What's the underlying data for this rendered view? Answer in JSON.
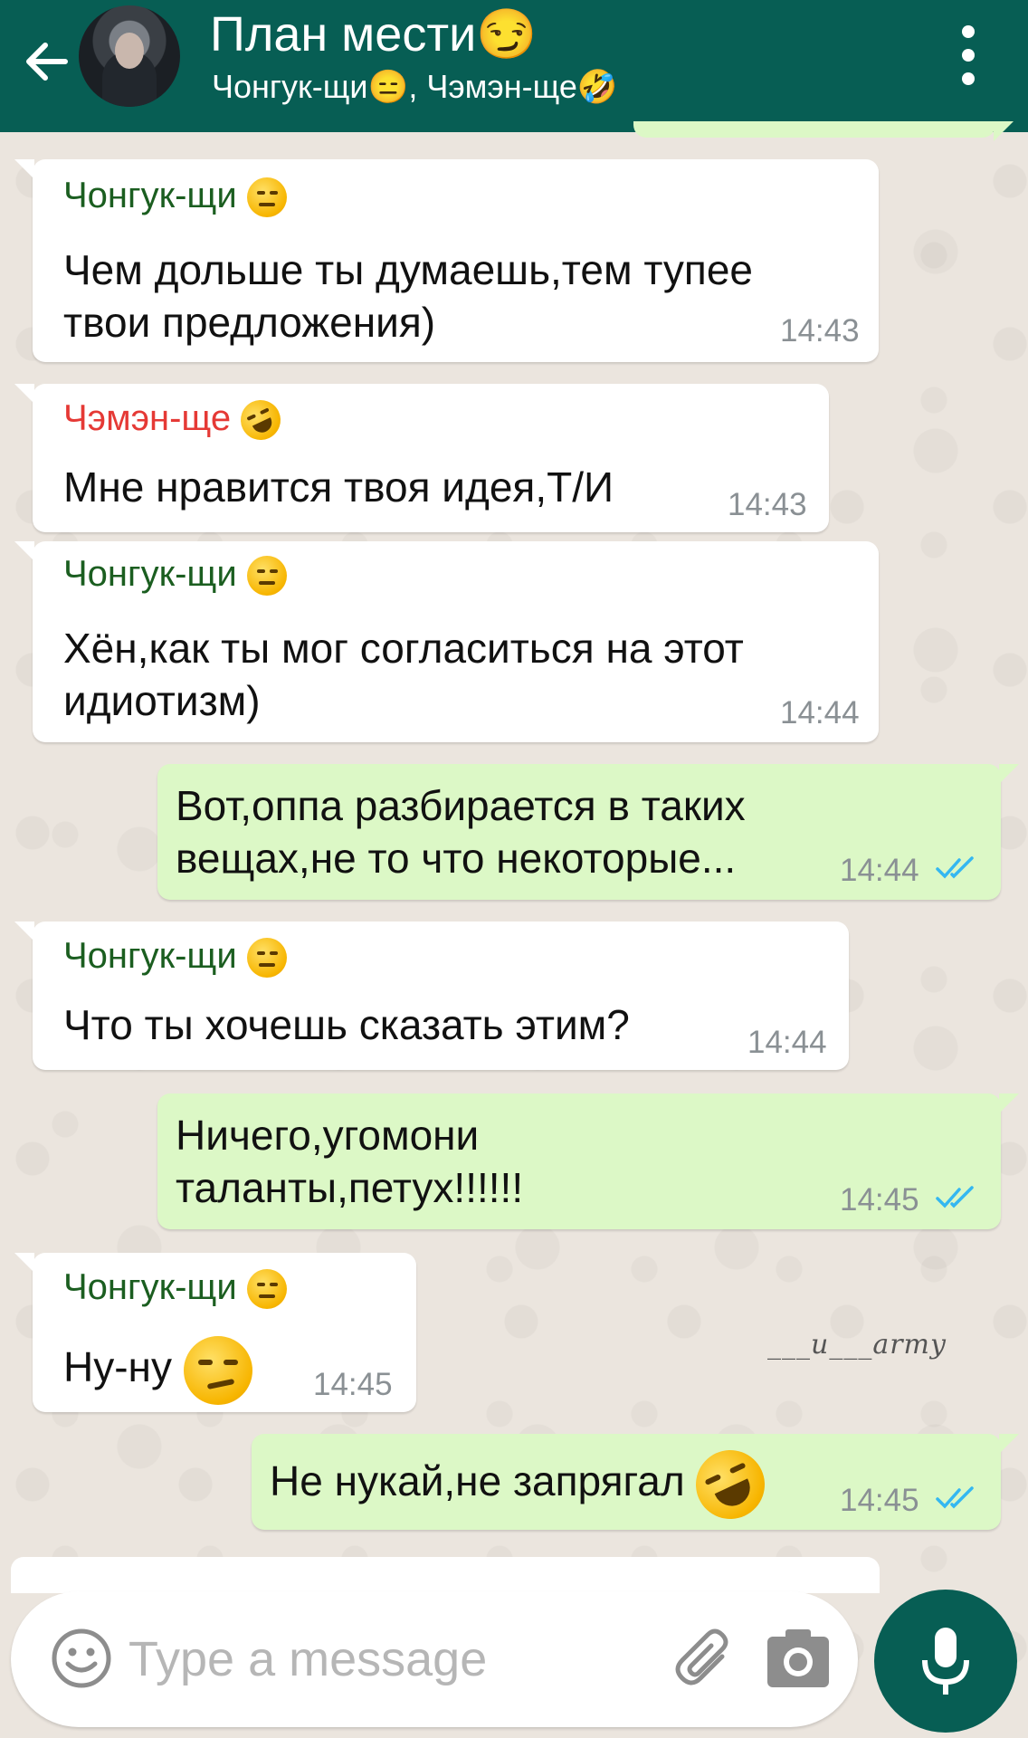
{
  "header": {
    "title": "План мести😏",
    "subtitle": "Чонгук-щи😑, Чэмэн-ще🤣"
  },
  "colors": {
    "header_bg": "#075e54",
    "incoming_bubble": "#ffffff",
    "outgoing_bubble": "#dcf8c6",
    "sender_jungkook": "#1b5e20",
    "sender_jimin": "#e53935",
    "read_ticks": "#34b7f1"
  },
  "messages": [
    {
      "direction": "in",
      "sender": "Чонгук-щи",
      "sender_emoji": "expressionless-face",
      "lines": [
        "Чем дольше ты думаешь,тем тупее",
        "твои предложения)"
      ],
      "time": "14:43"
    },
    {
      "direction": "in",
      "sender": "Чэмэн-ще",
      "sender_emoji": "rolling-laughing-face",
      "lines": [
        "Мне нравится твоя идея,Т/И"
      ],
      "time": "14:43"
    },
    {
      "direction": "in",
      "sender": "Чонгук-щи",
      "sender_emoji": "expressionless-face",
      "lines": [
        "Хён,как ты мог согласиться на этот",
        "идиотизм)"
      ],
      "time": "14:44"
    },
    {
      "direction": "out",
      "lines": [
        "Вот,оппа разбирается в таких",
        "вещах,не то что некоторые..."
      ],
      "time": "14:44",
      "status": "read"
    },
    {
      "direction": "in",
      "sender": "Чонгук-щи",
      "sender_emoji": "expressionless-face",
      "lines": [
        "Что ты хочешь сказать этим?"
      ],
      "time": "14:44"
    },
    {
      "direction": "out",
      "lines": [
        "Ничего,угомони",
        "таланты,петух!!!!!!"
      ],
      "time": "14:45",
      "status": "read"
    },
    {
      "direction": "in",
      "sender": "Чонгук-щи",
      "sender_emoji": "expressionless-face",
      "lines": [
        "Ну-ну"
      ],
      "message_emoji": "smirking-face",
      "time": "14:45"
    },
    {
      "direction": "out",
      "lines": [
        "Не нукай,не запрягал"
      ],
      "message_emoji": "rolling-laughing-face",
      "time": "14:45",
      "status": "read"
    }
  ],
  "watermark": "___u___army",
  "input": {
    "placeholder": "Type a message",
    "icons": [
      "smiley-icon",
      "attach-icon",
      "camera-icon",
      "mic-icon"
    ]
  }
}
